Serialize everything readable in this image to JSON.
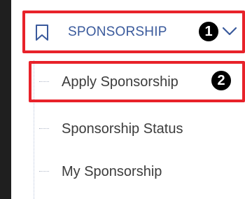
{
  "menu": {
    "section": {
      "label": "SPONSORSHIP",
      "icon": "bookmark-icon",
      "toggle_icon": "chevron-down-icon",
      "expanded": true
    },
    "items": [
      {
        "label": "Apply Sponsorship"
      },
      {
        "label": "Sponsorship Status"
      },
      {
        "label": "My Sponsorship"
      }
    ]
  },
  "annotations": [
    {
      "number": "1"
    },
    {
      "number": "2"
    }
  ],
  "colors": {
    "section_label": "#3a5a9c",
    "item_label": "#3c3c3c",
    "highlight": "#e8222a",
    "badge_bg": "#000000",
    "left_bar": "#1f1f1f"
  }
}
